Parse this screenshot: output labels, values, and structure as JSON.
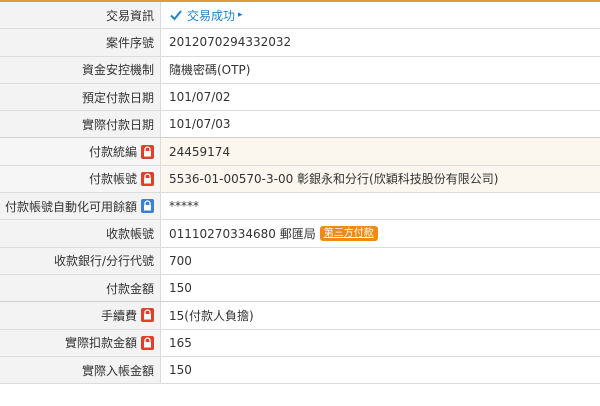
{
  "rows": [
    {
      "label": "交易資訊",
      "value": "交易成功",
      "status": true
    },
    {
      "label": "案件序號",
      "value": "2012070294332032"
    },
    {
      "label": "資金安控機制",
      "value": "隨機密碼(OTP)"
    },
    {
      "label": "預定付款日期",
      "value": "101/07/02"
    },
    {
      "label": "實際付款日期",
      "value": "101/07/03"
    },
    {
      "label": "付款統編",
      "value": "24459174",
      "lock": "red"
    },
    {
      "label": "付款帳號",
      "value": "5536-01-00570-3-00 彰銀永和分行(欣穎科技股份有限公司)",
      "lock": "red"
    },
    {
      "label": "付款帳號自動化可用餘額",
      "value": "*****",
      "lock": "blue"
    },
    {
      "label": "收款帳號",
      "value": "01110270334680 郵匯局",
      "tag": "第三方付款"
    },
    {
      "label": "收款銀行/分行代號",
      "value": "700"
    },
    {
      "label": "付款金額",
      "value": "150"
    },
    {
      "label": "手續費",
      "value": "15(付款人負擔)",
      "lock": "red"
    },
    {
      "label": "實際扣款金額",
      "value": "165",
      "lock": "red"
    },
    {
      "label": "實際入帳金額",
      "value": "150"
    }
  ],
  "icons": {
    "success": "check-icon",
    "lock_red": "lock-red-icon",
    "lock_blue": "lock-blue-icon"
  },
  "colors": {
    "accent_border": "#e39a3a",
    "success_text": "#1d82c8",
    "tag_bg": "#ef8a16",
    "lock_red": "#e0402a",
    "lock_blue": "#3b7fd6"
  }
}
